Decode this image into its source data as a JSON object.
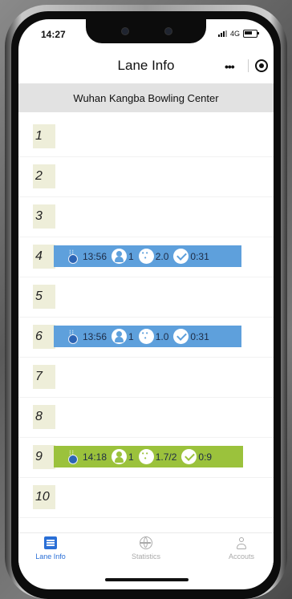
{
  "status_bar": {
    "time": "14:27",
    "network": "4G"
  },
  "nav": {
    "title": "Lane Info",
    "menu_glyph": "•••"
  },
  "header": {
    "venue": "Wuhan Kangba Bowling Center"
  },
  "lanes": [
    {
      "num": "1"
    },
    {
      "num": "2"
    },
    {
      "num": "3"
    },
    {
      "num": "4",
      "active": true,
      "color": "#5ea0dc",
      "time": "13:56",
      "players": "1",
      "score": "2.0",
      "duration": "0:31"
    },
    {
      "num": "5"
    },
    {
      "num": "6",
      "active": true,
      "color": "#5ea0dc",
      "time": "13:56",
      "players": "1",
      "score": "1.0",
      "duration": "0:31"
    },
    {
      "num": "7"
    },
    {
      "num": "8"
    },
    {
      "num": "9",
      "active": true,
      "color": "#9bc23c",
      "time": "14:18",
      "players": "1",
      "score": "1.7/2",
      "duration": "0:9"
    },
    {
      "num": "10"
    }
  ],
  "tabs": [
    {
      "label": "Lane Info",
      "icon": "list-icon",
      "active": true,
      "color": "#2a6fd6"
    },
    {
      "label": "Statistics",
      "icon": "globe-icon",
      "active": false
    },
    {
      "label": "Accouts",
      "icon": "user-icon",
      "active": false
    }
  ],
  "colors": {
    "accent": "#2a6fd6",
    "lane_blue": "#5ea0dc",
    "lane_green": "#9bc23c",
    "header_gray": "#e2e2e2"
  }
}
